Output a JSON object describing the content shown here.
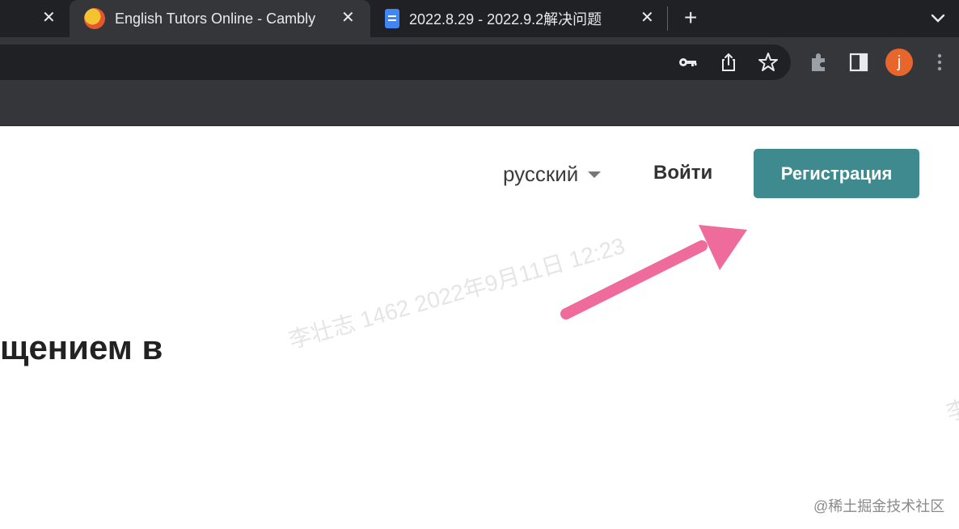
{
  "tabs": [
    {
      "title": "English Tutors Online - Cambly",
      "favicon": "cambly-logo-icon",
      "active": true
    },
    {
      "title": "2022.8.29 - 2022.9.2解决问题",
      "favicon": "google-docs-icon",
      "active": false
    }
  ],
  "toolbar": {
    "avatar_initial": "j"
  },
  "header": {
    "language": "русский",
    "login_label": "Войти",
    "signup_label": "Регистрация"
  },
  "hero": {
    "headline_fragment": "щением в"
  },
  "overlay": {
    "watermark": "李壮志 1462 2022年9月11日 12:23",
    "watermark_edge": "李",
    "credit": "@稀土掘金技术社区",
    "arrow_color": "#ee6b9b"
  },
  "colors": {
    "signup_bg": "#3e8a8e",
    "chrome_dark": "#202124",
    "chrome_toolbar": "#35363a"
  }
}
